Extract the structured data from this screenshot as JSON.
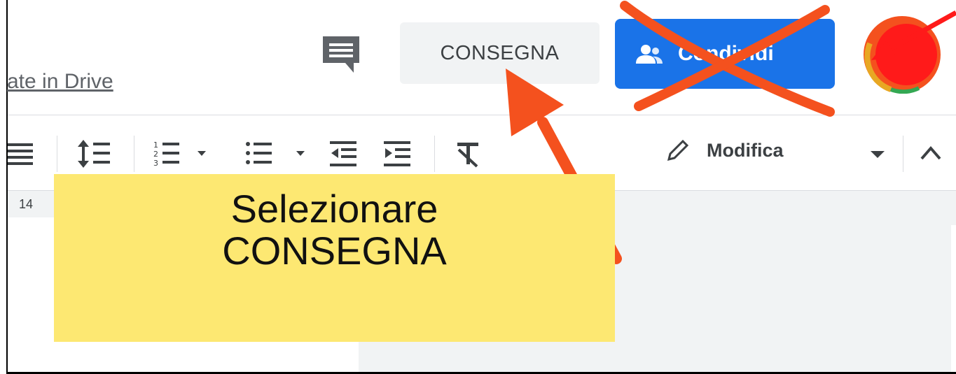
{
  "header": {
    "drive_link_text": "ate in Drive",
    "comment_icon": "comment-icon",
    "consegna_label": "CONSEGNA",
    "share_label": "Condividi",
    "share_icon": "people-icon",
    "avatar_icon": "user-avatar"
  },
  "toolbar": {
    "icons": [
      "align-justify-icon",
      "line-spacing-icon",
      "numbered-list-icon",
      "bulleted-list-icon",
      "decrease-indent-icon",
      "increase-indent-icon",
      "clear-formatting-icon"
    ],
    "edit_mode_label": "Modifica",
    "edit_mode_icon": "pencil-icon"
  },
  "ruler": {
    "number": "14"
  },
  "annotation": {
    "line1": "Selezionare",
    "line2": "CONSEGNA",
    "note_color": "#fde872",
    "arrow_color": "#f4511e",
    "red_arrow_color": "#ff1a1a"
  },
  "colors": {
    "share_button": "#1a73e8",
    "consegna_button": "#f1f3f4"
  }
}
